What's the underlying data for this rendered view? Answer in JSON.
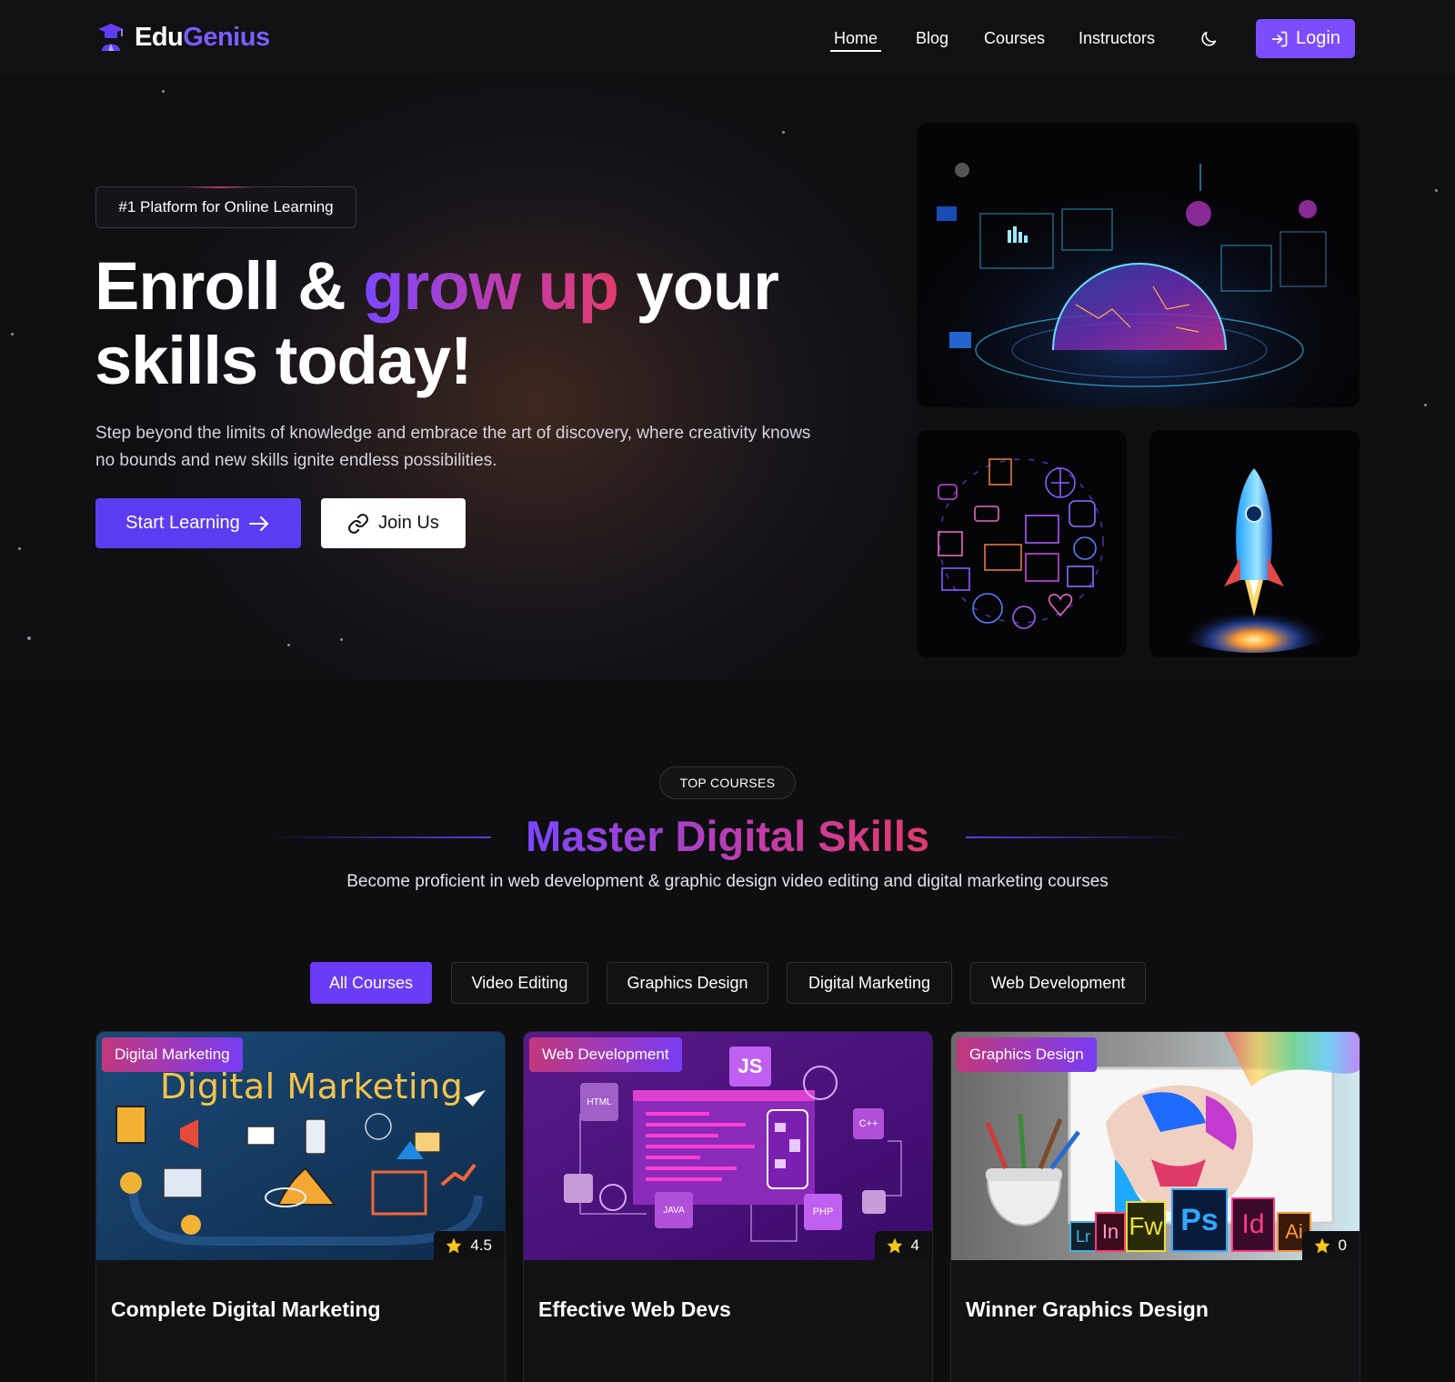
{
  "brand": {
    "name_part1": "Edu",
    "name_part2": "Genius",
    "accent": "#7c5cff"
  },
  "nav": {
    "links": [
      "Home",
      "Blog",
      "Courses",
      "Instructors"
    ],
    "active": "Home",
    "theme_toggle_icon": "moon-icon",
    "login_label": "Login"
  },
  "hero": {
    "badge": "#1 Platform for Online Learning",
    "title_part1": "Enroll & ",
    "title_highlight": "grow up",
    "title_part2": " your skills today!",
    "description": "Step beyond the limits of knowledge and embrace the art of discovery, where creativity knows no bounds and new skills ignite endless possibilities.",
    "primary_button": "Start Learning",
    "secondary_button": "Join Us"
  },
  "courses_section": {
    "eyebrow": "TOP COURSES",
    "title": "Master Digital Skills",
    "subtitle": "Become proficient in web development & graphic design video editing and digital marketing courses",
    "filters": [
      "All Courses",
      "Video Editing",
      "Graphics Design",
      "Digital Marketing",
      "Web Development"
    ],
    "active_filter": "All Courses",
    "cards": [
      {
        "category": "Digital Marketing",
        "rating": "4.5",
        "title": "Complete Digital Marketing",
        "image_caption": "Digital Marketing"
      },
      {
        "category": "Web Development",
        "rating": "4",
        "title": "Effective Web Devs",
        "image_labels": [
          "JS",
          "HTML",
          "C++",
          "JAVA",
          "PHP"
        ]
      },
      {
        "category": "Graphics Design",
        "rating": "0",
        "title": "Winner Graphics Design",
        "image_labels": [
          "Lr",
          "In",
          "Fw",
          "Ps",
          "Id",
          "Ai"
        ]
      }
    ]
  },
  "colors": {
    "background": "#0e0e10",
    "primary": "#5b3cf0",
    "gradient_start": "#7b47ff",
    "gradient_end": "#e03c6b"
  }
}
